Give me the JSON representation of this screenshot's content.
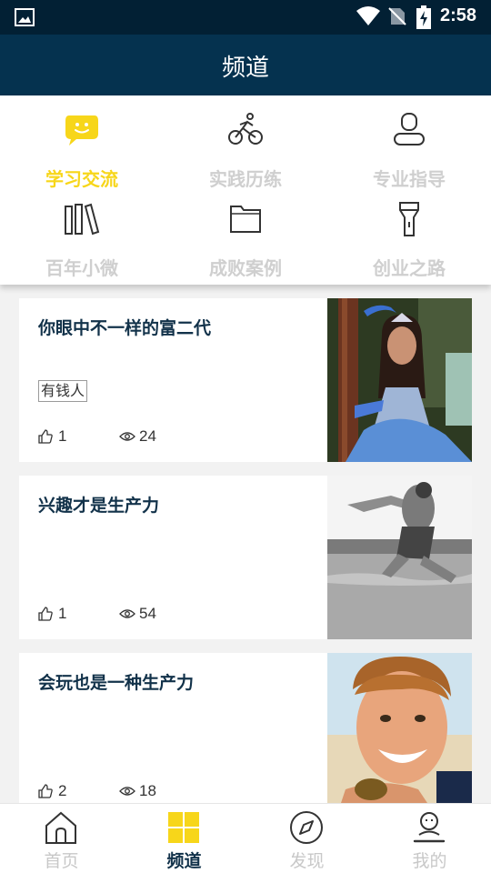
{
  "status_bar": {
    "time": "2:58"
  },
  "app_bar": {
    "title": "频道"
  },
  "channels": [
    {
      "label": "学习交流",
      "icon": "chat-bubble-icon",
      "active": true
    },
    {
      "label": "实践历练",
      "icon": "cyclist-icon",
      "active": false
    },
    {
      "label": "专业指导",
      "icon": "person-icon",
      "active": false
    },
    {
      "label": "百年小微",
      "icon": "books-icon",
      "active": false
    },
    {
      "label": "成败案例",
      "icon": "folder-icon",
      "active": false
    },
    {
      "label": "创业之路",
      "icon": "flashlight-icon",
      "active": false
    }
  ],
  "articles": [
    {
      "title": "你眼中不一样的富二代",
      "tag": "有钱人",
      "likes": "1",
      "views": "24"
    },
    {
      "title": "兴趣才是生产力",
      "likes": "1",
      "views": "54"
    },
    {
      "title": "会玩也是一种生产力",
      "likes": "2",
      "views": "18"
    }
  ],
  "tabs": [
    {
      "label": "首页",
      "icon": "home-icon",
      "active": false
    },
    {
      "label": "频道",
      "icon": "grid-icon",
      "active": true
    },
    {
      "label": "发现",
      "icon": "compass-icon",
      "active": false
    },
    {
      "label": "我的",
      "icon": "user-icon",
      "active": false
    }
  ],
  "colors": {
    "accent": "#f7d61a",
    "header": "#05324f",
    "statusbar": "#022034",
    "inactive": "#cfcfcf"
  }
}
